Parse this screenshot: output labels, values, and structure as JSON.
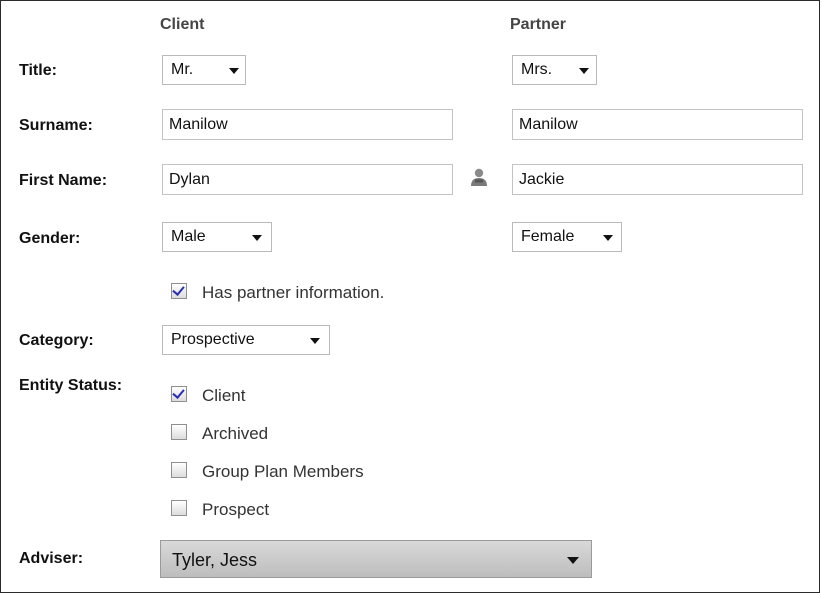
{
  "columns": {
    "client": "Client",
    "partner": "Partner"
  },
  "labels": {
    "title": "Title:",
    "surname": "Surname:",
    "first_name": "First Name:",
    "gender": "Gender:",
    "category": "Category:",
    "entity_status": "Entity Status:",
    "adviser": "Adviser:"
  },
  "client": {
    "title": "Mr.",
    "surname": "Manilow",
    "first_name": "Dylan",
    "gender": "Male"
  },
  "partner": {
    "title": "Mrs.",
    "surname": "Manilow",
    "first_name": "Jackie",
    "gender": "Female"
  },
  "has_partner": {
    "label": "Has partner information.",
    "checked": true
  },
  "category": {
    "value": "Prospective"
  },
  "entity_status": [
    {
      "label": "Client",
      "checked": true
    },
    {
      "label": "Archived",
      "checked": false
    },
    {
      "label": "Group Plan Members",
      "checked": false
    },
    {
      "label": "Prospect",
      "checked": false
    }
  ],
  "adviser": {
    "value": "Tyler, Jess"
  },
  "icons": {
    "copy_name": "person-icon"
  }
}
